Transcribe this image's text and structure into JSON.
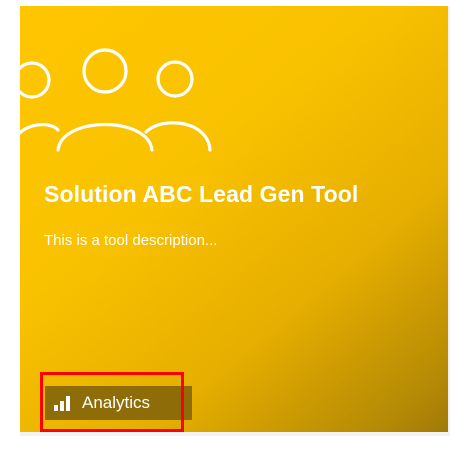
{
  "card": {
    "title": "Solution ABC Lead Gen Tool",
    "description": "This is a tool description...",
    "icon": "people-group-icon",
    "gradient": [
      "#ffc600",
      "#f9c200",
      "#e6ae00",
      "#b58a05",
      "#a07a08"
    ]
  },
  "badge": {
    "label": "Analytics",
    "icon": "bar-chart-icon",
    "background": "#8e6d08"
  },
  "highlight": {
    "color": "#ff0000"
  }
}
